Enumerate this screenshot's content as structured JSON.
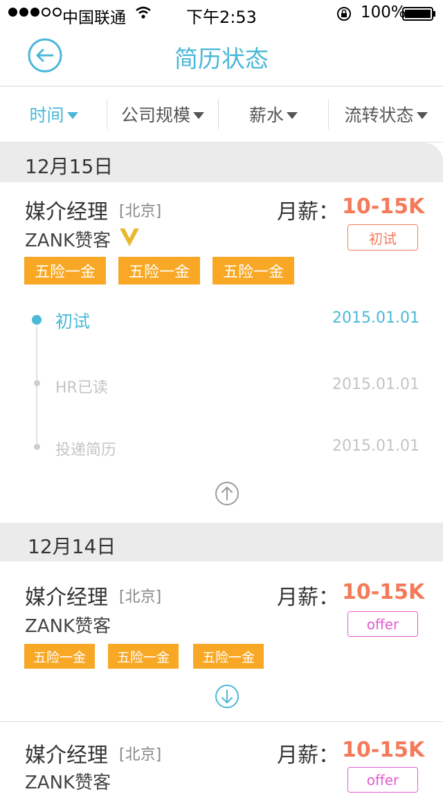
{
  "status_bar": {
    "carrier": "中国联通",
    "time": "下午2:53",
    "battery": "100%"
  },
  "nav": {
    "title": "简历状态",
    "back_icon": "back-arrow-circle-icon"
  },
  "filters": [
    {
      "label": "时间",
      "active": true
    },
    {
      "label": "公司规模",
      "active": false
    },
    {
      "label": "薪水",
      "active": false
    },
    {
      "label": "流转状态",
      "active": false
    }
  ],
  "sections": [
    {
      "date": "12月15日",
      "cards": [
        {
          "title": "媒介经理",
          "location": "[北京]",
          "salary_label": "月薪：",
          "salary": "10-15K",
          "company": "ZANK赞客",
          "verified_badge": "V",
          "status": "初试",
          "tags": [
            "五险一金",
            "五险一金",
            "五险一金"
          ],
          "timeline": [
            {
              "label": "初试",
              "date": "2015.01.01"
            },
            {
              "label": "HR已读",
              "date": "2015.01.01"
            },
            {
              "label": "投递简历",
              "date": "2015.01.01"
            }
          ],
          "toggle_icon": "collapse-up-arrow-icon"
        }
      ]
    },
    {
      "date": "12月14日",
      "cards": [
        {
          "title": "媒介经理",
          "location": "[北京]",
          "salary_label": "月薪：",
          "salary": "10-15K",
          "company": "ZANK赞客",
          "status": "offer",
          "tags": [
            "五险一金",
            "五险一金",
            "五险一金"
          ],
          "toggle_icon": "expand-down-arrow-icon"
        },
        {
          "title": "媒介经理",
          "location": "[北京]",
          "salary_label": "月薪：",
          "salary": "10-15K",
          "company": "ZANK赞客",
          "status": "offer"
        }
      ]
    }
  ],
  "colors": {
    "accent": "#4ab8d8",
    "salary": "#f47a5a",
    "tag": "#f9a825",
    "offer": "#e45ad2",
    "badge_gold": "#e8b830"
  }
}
